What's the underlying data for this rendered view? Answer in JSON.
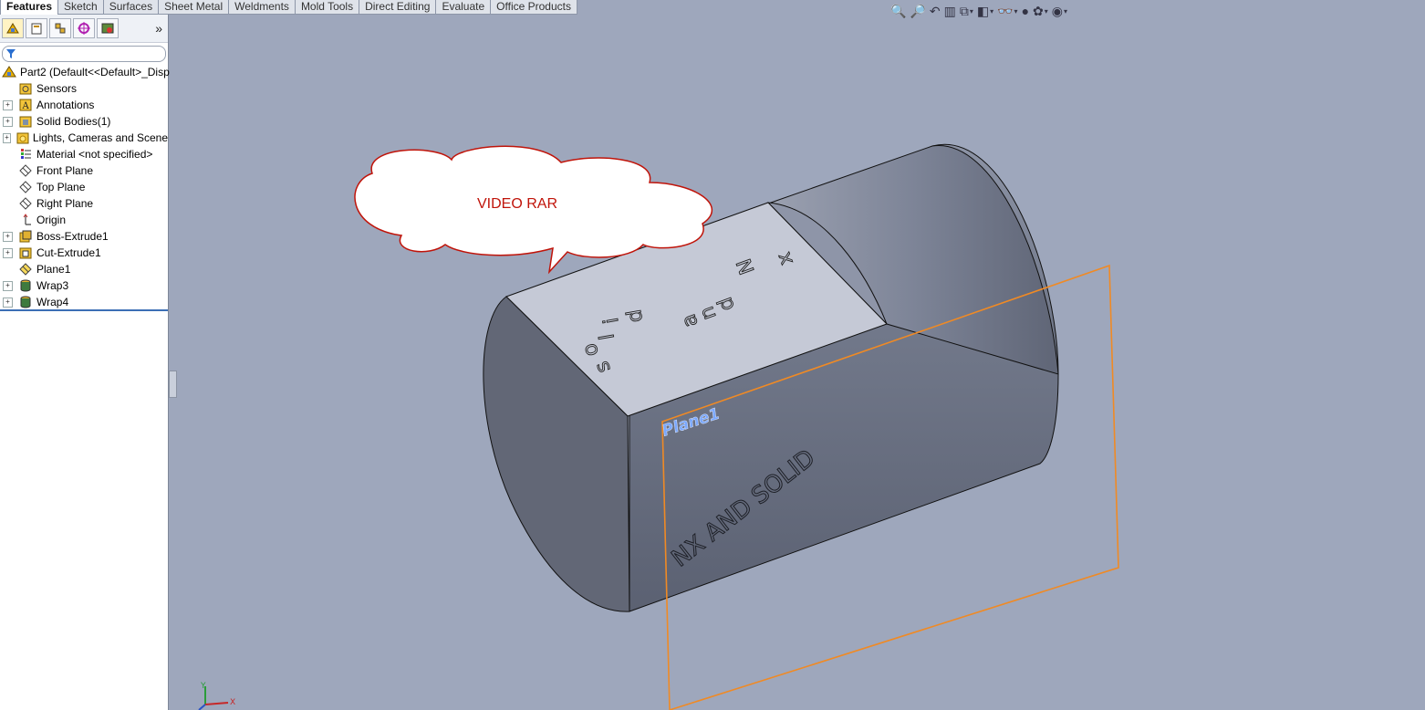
{
  "tabs": [
    "Features",
    "Sketch",
    "Surfaces",
    "Sheet Metal",
    "Weldments",
    "Mold Tools",
    "Direct Editing",
    "Evaluate",
    "Office Products"
  ],
  "active_tab": "Features",
  "panel": {
    "expand_label": "»",
    "root": "Part2  (Default<<Default>_Disp",
    "items": [
      {
        "label": "Sensors",
        "icon": "sensor-icon",
        "expandable": false
      },
      {
        "label": "Annotations",
        "icon": "annotations-icon",
        "expandable": true
      },
      {
        "label": "Solid Bodies(1)",
        "icon": "solid-bodies-icon",
        "expandable": true
      },
      {
        "label": "Lights, Cameras and Scene",
        "icon": "lights-icon",
        "expandable": true
      },
      {
        "label": "Material <not specified>",
        "icon": "material-icon",
        "expandable": false
      },
      {
        "label": "Front Plane",
        "icon": "plane-icon",
        "expandable": false
      },
      {
        "label": "Top Plane",
        "icon": "plane-icon",
        "expandable": false
      },
      {
        "label": "Right Plane",
        "icon": "plane-icon",
        "expandable": false
      },
      {
        "label": "Origin",
        "icon": "origin-icon",
        "expandable": false
      },
      {
        "label": "Boss-Extrude1",
        "icon": "boss-extrude-icon",
        "expandable": true
      },
      {
        "label": "Cut-Extrude1",
        "icon": "cut-extrude-icon",
        "expandable": true
      },
      {
        "label": "Plane1",
        "icon": "plane-icon",
        "expandable": false
      },
      {
        "label": "Wrap3",
        "icon": "wrap-icon",
        "expandable": true
      },
      {
        "label": "Wrap4",
        "icon": "wrap-icon",
        "expandable": true
      }
    ]
  },
  "viewport": {
    "callout_text": "VIDEO RAR",
    "plane_label": "Plane1",
    "top_text": [
      "s",
      "o",
      "l",
      "i",
      "d",
      "a",
      "n",
      "d",
      "N",
      "x"
    ],
    "side_text": "NX AND SOLID",
    "triad_x": "X",
    "triad_y": "Y",
    "colors": {
      "background": "#9ea7bc",
      "plane": "#f08a24",
      "callout_border": "#c0140a",
      "plane_label": "#7aa8ff"
    }
  }
}
